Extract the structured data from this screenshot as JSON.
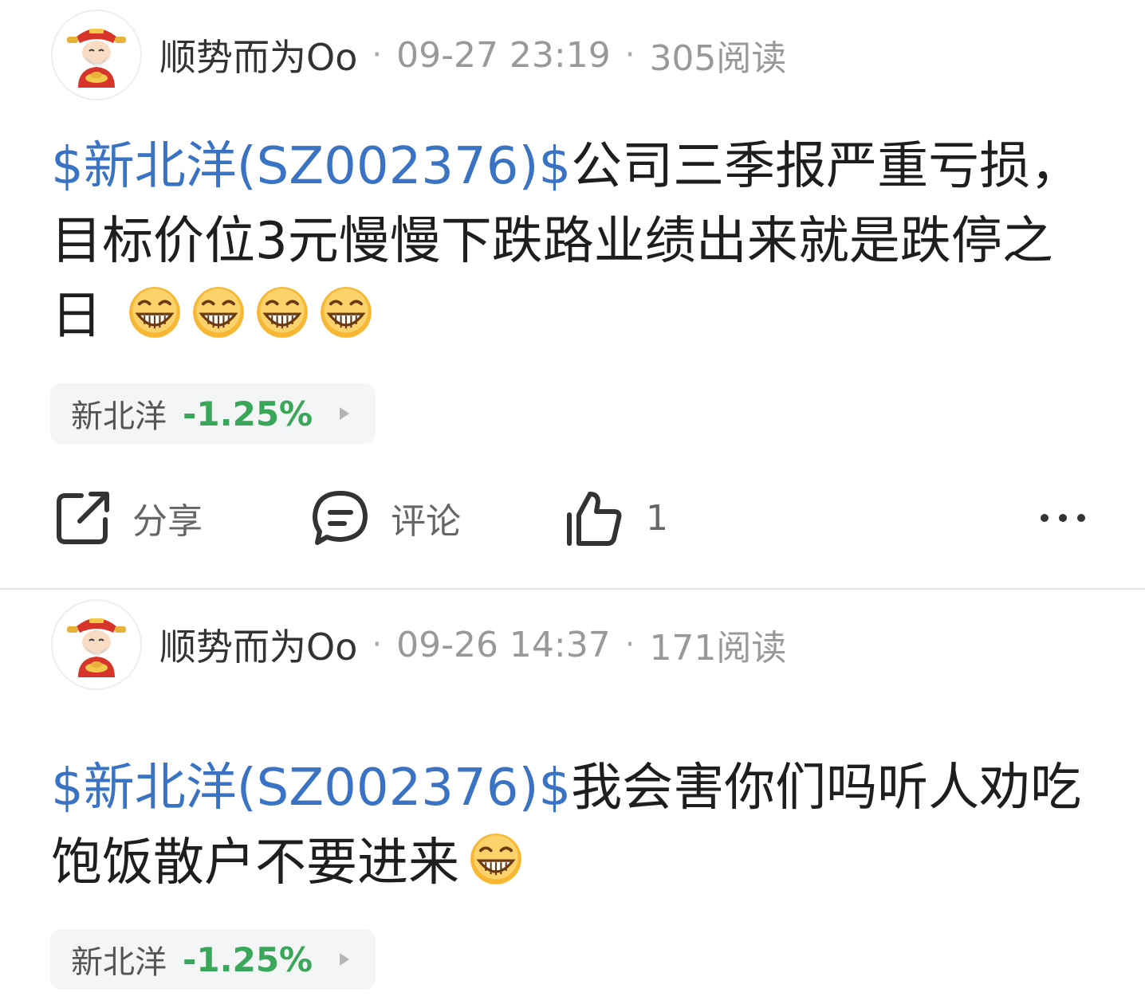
{
  "posts": [
    {
      "author": "顺势而为Oo",
      "time": "09-27 23:19",
      "reads": "305阅读",
      "stock_tag": "$新北洋(SZ002376)$",
      "text": "公司三季报严重亏损，目标价位3元慢慢下跌路业绩出来就是跌停之日",
      "emoji_count": 4,
      "chip": {
        "name": "新北洋",
        "change": "-1.25%"
      },
      "actions": {
        "share": "分享",
        "comment": "评论",
        "like_count": "1"
      }
    },
    {
      "author": "顺势而为Oo",
      "time": "09-26 14:37",
      "reads": "171阅读",
      "stock_tag": "$新北洋(SZ002376)$",
      "text": "我会害你们吗听人劝吃饱饭散户不要进来",
      "emoji_count": 1,
      "chip": {
        "name": "新北洋",
        "change": "-1.25%"
      }
    }
  ],
  "colors": {
    "link": "#3a72c4",
    "change_negative": "#3aa65a",
    "meta_gray": "#999999"
  },
  "icons": [
    "avatar-god-of-wealth",
    "share-icon",
    "comment-icon",
    "thumbs-up-icon",
    "more-icon",
    "grin-emoji"
  ]
}
